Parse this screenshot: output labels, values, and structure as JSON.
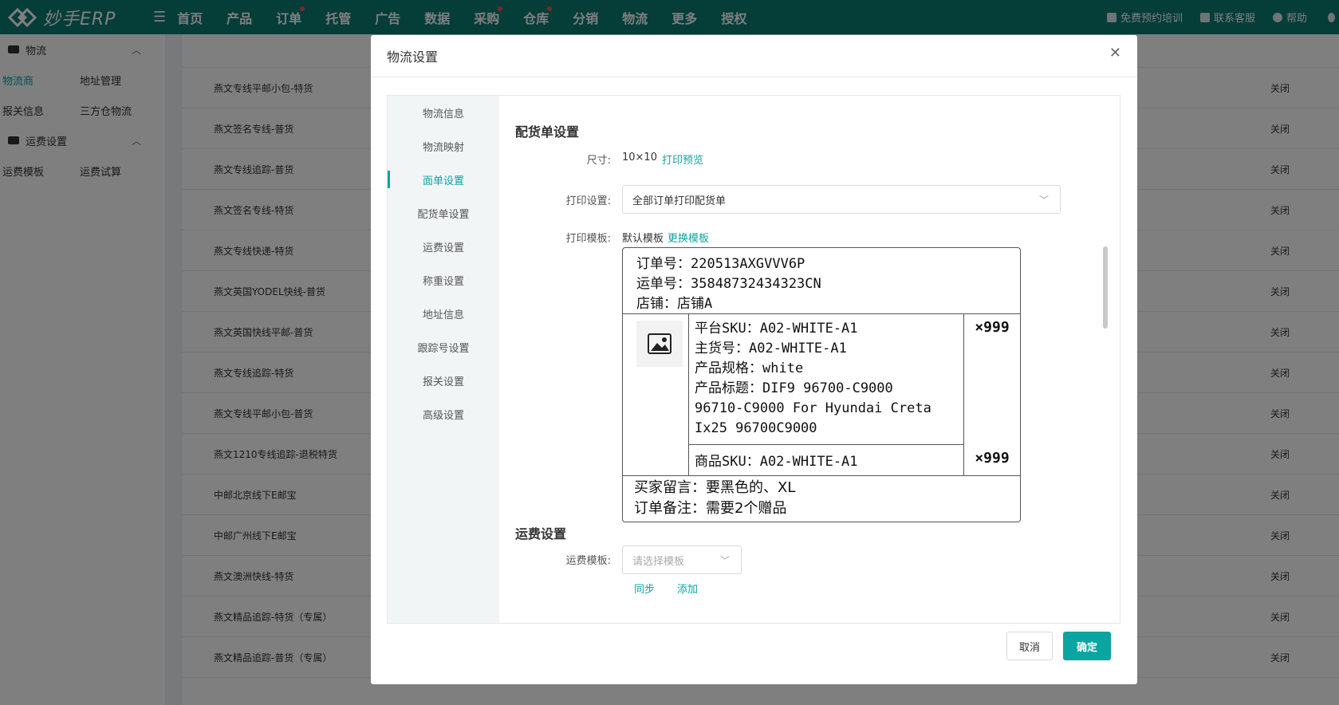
{
  "app": {
    "logo_text": "妙手ERP"
  },
  "topnav": {
    "items": [
      {
        "label": "首页",
        "dot": false
      },
      {
        "label": "产品",
        "dot": false
      },
      {
        "label": "订单",
        "dot": true
      },
      {
        "label": "托管",
        "dot": false
      },
      {
        "label": "广告",
        "dot": false
      },
      {
        "label": "数据",
        "dot": false
      },
      {
        "label": "采购",
        "dot": true
      },
      {
        "label": "仓库",
        "dot": true
      },
      {
        "label": "分销",
        "dot": false
      },
      {
        "label": "物流",
        "dot": false
      },
      {
        "label": "更多",
        "dot": false
      },
      {
        "label": "授权",
        "dot": false
      }
    ],
    "right": {
      "training": "免费预约培训",
      "service": "联系客服",
      "help": "帮助"
    }
  },
  "sidebar": {
    "group1": "物流",
    "row1": [
      "物流商",
      "地址管理"
    ],
    "row2": [
      "报关信息",
      "三方仓物流"
    ],
    "group2": "运费设置",
    "row3": [
      "运费模板",
      "运费试算"
    ]
  },
  "table": {
    "rows": [
      {
        "name": "燕文专线平邮小包-特货",
        "status": "关闭"
      },
      {
        "name": "燕文签名专线-普货",
        "status": "关闭"
      },
      {
        "name": "燕文专线追踪-普货",
        "status": "关闭"
      },
      {
        "name": "燕文签名专线-特货",
        "status": "关闭"
      },
      {
        "name": "燕文专线快递-特货",
        "status": "关闭"
      },
      {
        "name": "燕文英国YODEL快线-普货",
        "status": "关闭"
      },
      {
        "name": "燕文英国快线平邮-普货",
        "status": "关闭"
      },
      {
        "name": "燕文专线追踪-特货",
        "status": "关闭"
      },
      {
        "name": "燕文专线平邮小包-普货",
        "status": "关闭"
      },
      {
        "name": "燕文1210专线追踪-退税特货",
        "status": "关闭"
      },
      {
        "name": "中邮北京线下E邮宝",
        "status": "关闭"
      },
      {
        "name": "中邮广州线下E邮宝",
        "status": "关闭"
      },
      {
        "name": "燕文澳洲快线-特货",
        "status": "关闭"
      },
      {
        "name": "燕文精品追踪-特货（专属）",
        "status": "关闭"
      },
      {
        "name": "燕文精品追踪-普货（专属）",
        "status": "关闭"
      }
    ]
  },
  "modal": {
    "title": "物流设置",
    "tabs": [
      "物流信息",
      "物流映射",
      "面单设置",
      "配货单设置",
      "运费设置",
      "称重设置",
      "地址信息",
      "跟踪号设置",
      "报关设置",
      "高级设置"
    ],
    "active_tab": "面单设置",
    "packing_section": {
      "title": "配货单设置",
      "size_label": "尺寸:",
      "size_value": "10×10",
      "preview_link": "打印预览",
      "print_setting_label": "打印设置:",
      "print_setting_value": "全部订单打印配货单",
      "template_label": "打印模板:",
      "template_value": "默认模板",
      "change_template_link": "更换模板"
    },
    "label_preview": {
      "order_no": "订单号：220513AXGVVV6P",
      "tracking_no": "运单号：35848732434323CN",
      "shop": "店铺：店铺A",
      "platform_sku": "平台SKU：A02-WHITE-A1",
      "main_sku": "主货号：A02-WHITE-A1",
      "spec": "产品规格：white",
      "title_line1": "产品标题：DIF9 96700-C9000",
      "title_line2": "96710-C9000 For Hyundai Creta",
      "title_line3": "Ix25 96700C9000",
      "qty1": "×999",
      "item_sku": "商品SKU：A02-WHITE-A1",
      "qty2": "×999",
      "buyer_note": "买家留言：要黑色的、XL",
      "order_note": "订单备注：需要2个赠品"
    },
    "freight_section": {
      "title": "运费设置",
      "template_label": "运费模板:",
      "template_placeholder": "请选择模板",
      "sync_link": "同步",
      "add_link": "添加"
    },
    "buttons": {
      "cancel": "取消",
      "ok": "确定"
    }
  },
  "colors": {
    "brand": "#0a7b73",
    "accent": "#0aa5a0",
    "dot": "#ff4d4f"
  }
}
